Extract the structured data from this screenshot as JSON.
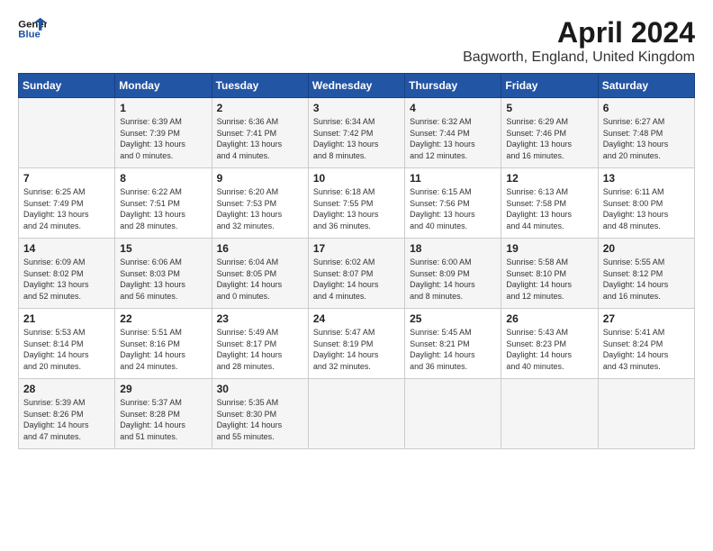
{
  "header": {
    "logo_line1": "General",
    "logo_line2": "Blue",
    "title": "April 2024",
    "subtitle": "Bagworth, England, United Kingdom"
  },
  "days_of_week": [
    "Sunday",
    "Monday",
    "Tuesday",
    "Wednesday",
    "Thursday",
    "Friday",
    "Saturday"
  ],
  "weeks": [
    [
      {
        "day": "",
        "text": ""
      },
      {
        "day": "1",
        "text": "Sunrise: 6:39 AM\nSunset: 7:39 PM\nDaylight: 13 hours\nand 0 minutes."
      },
      {
        "day": "2",
        "text": "Sunrise: 6:36 AM\nSunset: 7:41 PM\nDaylight: 13 hours\nand 4 minutes."
      },
      {
        "day": "3",
        "text": "Sunrise: 6:34 AM\nSunset: 7:42 PM\nDaylight: 13 hours\nand 8 minutes."
      },
      {
        "day": "4",
        "text": "Sunrise: 6:32 AM\nSunset: 7:44 PM\nDaylight: 13 hours\nand 12 minutes."
      },
      {
        "day": "5",
        "text": "Sunrise: 6:29 AM\nSunset: 7:46 PM\nDaylight: 13 hours\nand 16 minutes."
      },
      {
        "day": "6",
        "text": "Sunrise: 6:27 AM\nSunset: 7:48 PM\nDaylight: 13 hours\nand 20 minutes."
      }
    ],
    [
      {
        "day": "7",
        "text": "Sunrise: 6:25 AM\nSunset: 7:49 PM\nDaylight: 13 hours\nand 24 minutes."
      },
      {
        "day": "8",
        "text": "Sunrise: 6:22 AM\nSunset: 7:51 PM\nDaylight: 13 hours\nand 28 minutes."
      },
      {
        "day": "9",
        "text": "Sunrise: 6:20 AM\nSunset: 7:53 PM\nDaylight: 13 hours\nand 32 minutes."
      },
      {
        "day": "10",
        "text": "Sunrise: 6:18 AM\nSunset: 7:55 PM\nDaylight: 13 hours\nand 36 minutes."
      },
      {
        "day": "11",
        "text": "Sunrise: 6:15 AM\nSunset: 7:56 PM\nDaylight: 13 hours\nand 40 minutes."
      },
      {
        "day": "12",
        "text": "Sunrise: 6:13 AM\nSunset: 7:58 PM\nDaylight: 13 hours\nand 44 minutes."
      },
      {
        "day": "13",
        "text": "Sunrise: 6:11 AM\nSunset: 8:00 PM\nDaylight: 13 hours\nand 48 minutes."
      }
    ],
    [
      {
        "day": "14",
        "text": "Sunrise: 6:09 AM\nSunset: 8:02 PM\nDaylight: 13 hours\nand 52 minutes."
      },
      {
        "day": "15",
        "text": "Sunrise: 6:06 AM\nSunset: 8:03 PM\nDaylight: 13 hours\nand 56 minutes."
      },
      {
        "day": "16",
        "text": "Sunrise: 6:04 AM\nSunset: 8:05 PM\nDaylight: 14 hours\nand 0 minutes."
      },
      {
        "day": "17",
        "text": "Sunrise: 6:02 AM\nSunset: 8:07 PM\nDaylight: 14 hours\nand 4 minutes."
      },
      {
        "day": "18",
        "text": "Sunrise: 6:00 AM\nSunset: 8:09 PM\nDaylight: 14 hours\nand 8 minutes."
      },
      {
        "day": "19",
        "text": "Sunrise: 5:58 AM\nSunset: 8:10 PM\nDaylight: 14 hours\nand 12 minutes."
      },
      {
        "day": "20",
        "text": "Sunrise: 5:55 AM\nSunset: 8:12 PM\nDaylight: 14 hours\nand 16 minutes."
      }
    ],
    [
      {
        "day": "21",
        "text": "Sunrise: 5:53 AM\nSunset: 8:14 PM\nDaylight: 14 hours\nand 20 minutes."
      },
      {
        "day": "22",
        "text": "Sunrise: 5:51 AM\nSunset: 8:16 PM\nDaylight: 14 hours\nand 24 minutes."
      },
      {
        "day": "23",
        "text": "Sunrise: 5:49 AM\nSunset: 8:17 PM\nDaylight: 14 hours\nand 28 minutes."
      },
      {
        "day": "24",
        "text": "Sunrise: 5:47 AM\nSunset: 8:19 PM\nDaylight: 14 hours\nand 32 minutes."
      },
      {
        "day": "25",
        "text": "Sunrise: 5:45 AM\nSunset: 8:21 PM\nDaylight: 14 hours\nand 36 minutes."
      },
      {
        "day": "26",
        "text": "Sunrise: 5:43 AM\nSunset: 8:23 PM\nDaylight: 14 hours\nand 40 minutes."
      },
      {
        "day": "27",
        "text": "Sunrise: 5:41 AM\nSunset: 8:24 PM\nDaylight: 14 hours\nand 43 minutes."
      }
    ],
    [
      {
        "day": "28",
        "text": "Sunrise: 5:39 AM\nSunset: 8:26 PM\nDaylight: 14 hours\nand 47 minutes."
      },
      {
        "day": "29",
        "text": "Sunrise: 5:37 AM\nSunset: 8:28 PM\nDaylight: 14 hours\nand 51 minutes."
      },
      {
        "day": "30",
        "text": "Sunrise: 5:35 AM\nSunset: 8:30 PM\nDaylight: 14 hours\nand 55 minutes."
      },
      {
        "day": "",
        "text": ""
      },
      {
        "day": "",
        "text": ""
      },
      {
        "day": "",
        "text": ""
      },
      {
        "day": "",
        "text": ""
      }
    ]
  ]
}
